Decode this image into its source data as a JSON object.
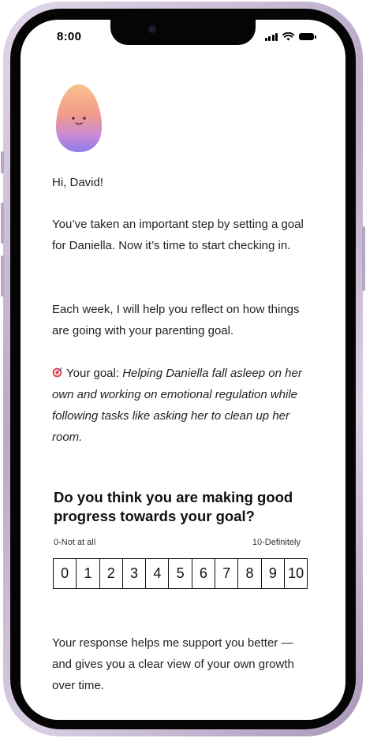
{
  "status_bar": {
    "time": "8:00"
  },
  "message": {
    "greeting": "Hi, David!",
    "intro": "You’ve taken an important step by setting a goal for Daniella. Now it’s time to start checking in.",
    "weekly": "Each week, I will help you reflect on how things are going with your parenting goal.",
    "goal_label": "Your goal:",
    "goal_text": "Helping Daniella fall asleep on her own and working on emotional regulation while following tasks like asking her to clean up her room."
  },
  "question": {
    "text": "Do you think you are making good progress towards your goal?",
    "min_label": "0-Not at all",
    "max_label": "10-Definitely",
    "options": [
      "0",
      "1",
      "2",
      "3",
      "4",
      "5",
      "6",
      "7",
      "8",
      "9",
      "10"
    ]
  },
  "footer": {
    "text": "Your response helps me support you better — and gives you a clear view of your own growth over time."
  },
  "icons": {
    "goal_icon": "target-dart-icon",
    "mascot": "egg-mascot-icon"
  },
  "colors": {
    "frame": "#c7b6d4",
    "text": "#222222"
  }
}
